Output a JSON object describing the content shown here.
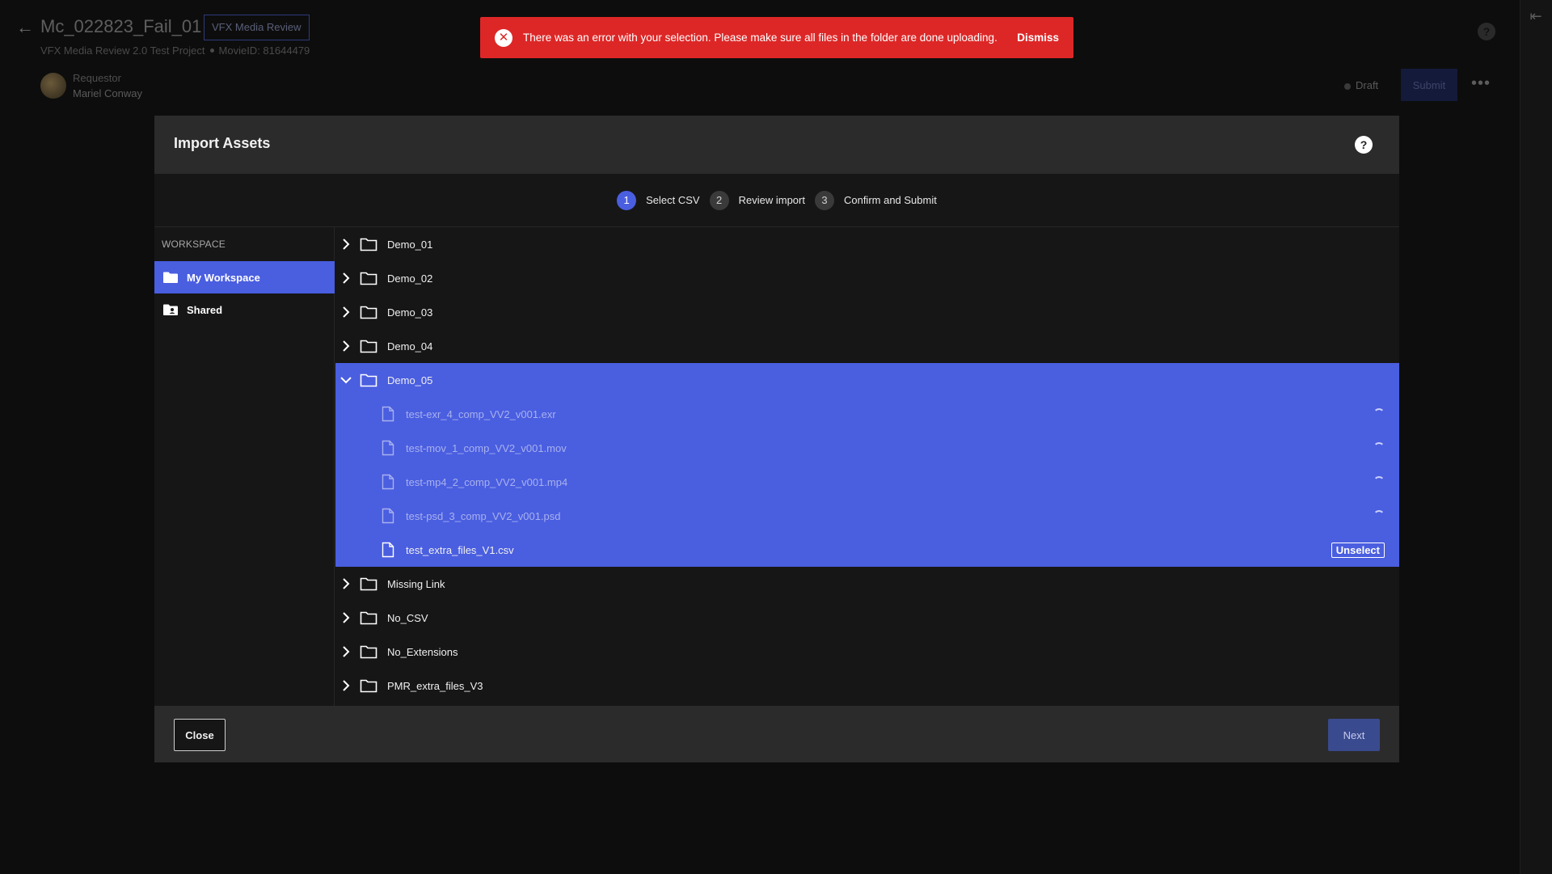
{
  "background": {
    "title": "Mc_022823_Fail_01",
    "badge": "VFX Media Review",
    "project": "VFX Media Review 2.0 Test Project",
    "movie_id": "MovieID: 81644479",
    "requestor_label": "Requestor",
    "requestor_name": "Mariel Conway",
    "status": "Draft",
    "submit_label": "Submit"
  },
  "toast": {
    "message": "There was an error with your selection. Please make sure all files in the folder are done uploading.",
    "dismiss_label": "Dismiss",
    "color": "#dd2727"
  },
  "modal": {
    "title": "Import Assets",
    "steps": [
      {
        "num": "1",
        "label": "Select CSV"
      },
      {
        "num": "2",
        "label": "Review import"
      },
      {
        "num": "3",
        "label": "Confirm and Submit"
      }
    ],
    "sidebar": {
      "heading": "WORKSPACE",
      "items": [
        {
          "label": "My Workspace"
        },
        {
          "label": "Shared"
        }
      ]
    },
    "tree": {
      "folders": [
        "Demo_01",
        "Demo_02",
        "Demo_03",
        "Demo_04",
        "Demo_05",
        "Missing Link",
        "No_CSV",
        "No_Extensions",
        "PMR_extra_files_V3"
      ],
      "files": [
        "test-exr_4_comp_VV2_v001.exr",
        "test-mov_1_comp_VV2_v001.mov",
        "test-mp4_2_comp_VV2_v001.mp4",
        "test-psd_3_comp_VV2_v001.psd",
        "test_extra_files_V1.csv"
      ],
      "unselect_label": "Unselect"
    },
    "close_label": "Close",
    "next_label": "Next",
    "accent": "#4a5ee0"
  }
}
